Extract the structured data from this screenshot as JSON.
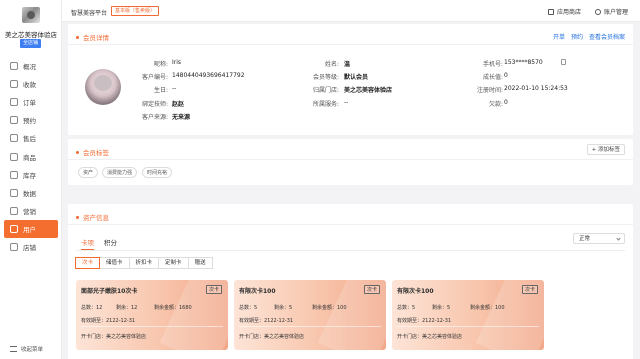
{
  "sidebar": {
    "store_name": "美之芯美容体验店",
    "store_badge": "全店铺",
    "items": [
      {
        "label": "概况",
        "icon": "overview-icon"
      },
      {
        "label": "收款",
        "icon": "payment-icon"
      },
      {
        "label": "订单",
        "icon": "order-icon"
      },
      {
        "label": "预约",
        "icon": "appointment-icon"
      },
      {
        "label": "售后",
        "icon": "after-sales-icon"
      },
      {
        "label": "商品",
        "icon": "goods-icon"
      },
      {
        "label": "库存",
        "icon": "inventory-icon"
      },
      {
        "label": "数据",
        "icon": "data-icon"
      },
      {
        "label": "营销",
        "icon": "marketing-icon"
      },
      {
        "label": "用户",
        "icon": "user-icon"
      },
      {
        "label": "店铺",
        "icon": "shop-icon"
      }
    ],
    "active_index": 9,
    "collapse_label": "收起菜单"
  },
  "topbar": {
    "platform": "智慧美容平台",
    "edition": "基本版（售卖版）",
    "app_store": "应用商店",
    "account": "账户管理"
  },
  "member_detail": {
    "title": "会员详情",
    "actions": [
      "开单",
      "预约",
      "查看会员档案"
    ],
    "col1": [
      {
        "label": "昵称:",
        "value": "Iris",
        "bold": false
      },
      {
        "label": "客户编号:",
        "value": "1480440493696417792",
        "bold": false
      },
      {
        "label": "生日:",
        "value": "--",
        "bold": false
      },
      {
        "label": "绑定技师:",
        "value": "赵赵",
        "bold": true
      },
      {
        "label": "客户来源:",
        "value": "无来源",
        "bold": true
      }
    ],
    "col2": [
      {
        "label": "姓名:",
        "value": "温",
        "bold": true
      },
      {
        "label": "会员等级:",
        "value": "默认会员",
        "bold": true
      },
      {
        "label": "归属门店:",
        "value": "美之芯美容体验店",
        "bold": true
      },
      {
        "label": "所属服务:",
        "value": "--",
        "bold": false
      }
    ],
    "col3": [
      {
        "label": "手机号:",
        "value": "153****8570",
        "bold": false
      },
      {
        "label": "成长值:",
        "value": "0",
        "bold": false
      },
      {
        "label": "注册时间:",
        "value": "2022-01-10 15:24:53",
        "bold": false
      },
      {
        "label": "欠款:",
        "value": "0",
        "bold": false
      }
    ]
  },
  "member_tags": {
    "title": "会员标签",
    "add_label": "+ 添加标签",
    "tags": [
      "资产",
      "消费能力强",
      "时间充裕"
    ]
  },
  "assets": {
    "title": "资产信息",
    "tabs": [
      "卡项",
      "积分"
    ],
    "active_tab": 0,
    "filter": "正常",
    "subtabs": [
      "次卡",
      "储值卡",
      "折扣卡",
      "定制卡",
      "赠送"
    ],
    "active_subtab": 0,
    "cards": [
      {
        "name": "面部光子嫩肤10次卡",
        "type": "次卡",
        "total": "总数：12",
        "remain": "剩余：12",
        "remain_amount": "剩余金额：1680",
        "expiry": "有效期至：2122-12-31",
        "store": "开卡门店：美之芯美容体验店"
      },
      {
        "name": "有限次卡100",
        "type": "次卡",
        "total": "总数：5",
        "remain": "剩余：5",
        "remain_amount": "剩余金额：100",
        "expiry": "有效期至：2122-12-31",
        "store": "开卡门店：美之芯美容体验店"
      },
      {
        "name": "有限次卡100",
        "type": "次卡",
        "total": "总数：5",
        "remain": "剩余：5",
        "remain_amount": "剩余金额：100",
        "expiry": "有效期至：2122-12-31",
        "store": "开卡门店：美之芯美容体验店"
      }
    ]
  }
}
